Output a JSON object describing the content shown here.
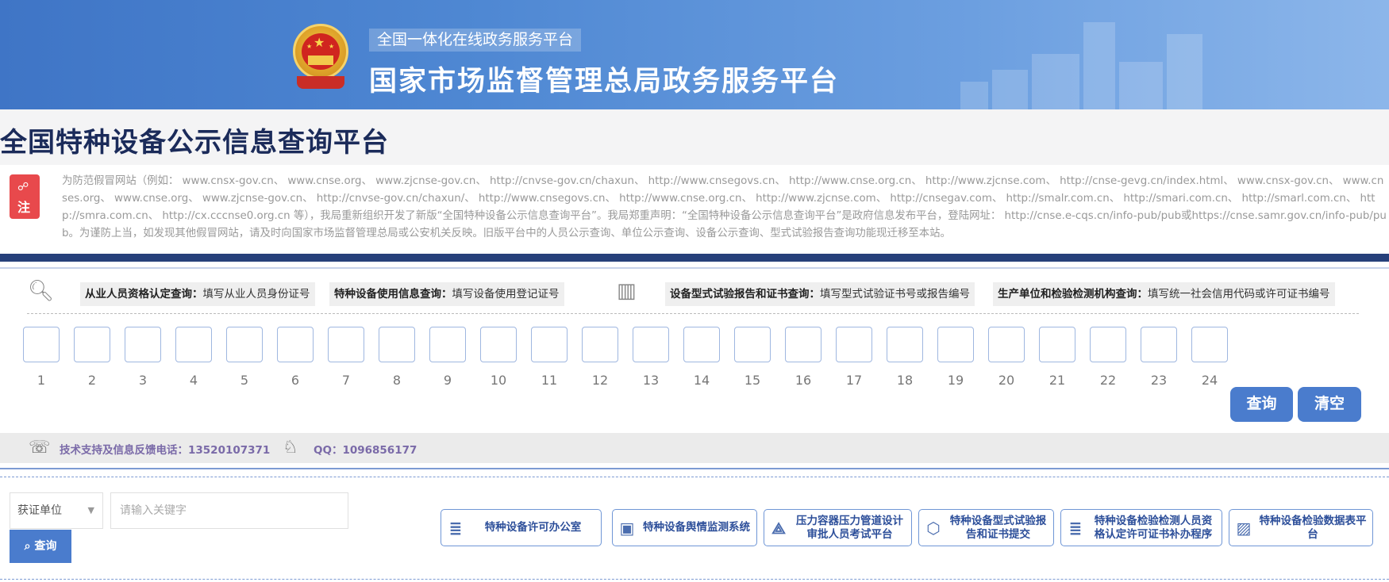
{
  "header": {
    "subtitle": "全国一体化在线政务服务平台",
    "title": "国家市场监督管理总局政务服务平台"
  },
  "platform_title": "全国特种设备公示信息查询平台",
  "notice": {
    "badge": "注",
    "text": "为防范假冒网站（例如： www.cnsx-gov.cn、 www.cnse.org、 www.zjcnse-gov.cn、 http://cnvse-gov.cn/chaxun、 http://www.cnsegovs.cn、 http://www.cnse.org.cn、 http://www.zjcnse.com、 http://cnse-gevg.cn/index.html、 www.cnsx-gov.cn、 www.cnses.org、 www.cnse.org、 www.zjcnse-gov.cn、 http://cnvse-gov.cn/chaxun/、 http://www.cnsegovs.cn、 http://www.cnse.org.cn、 http://www.zjcnse.com、 http://cnsegav.com、 http://smalr.com.cn、 http://smari.com.cn、 http://smarl.com.cn、 http://smra.com.cn、 http://cx.cccnse0.org.cn 等），我局重新组织开发了新版“全国特种设备公示信息查询平台”。我局郑重声明：“全国特种设备公示信息查询平台”是政府信息发布平台，登陆网址： http://cnse.e-cqs.cn/info-pub/pub或https://cnse.samr.gov.cn/info-pub/pub。为谨防上当，如发现其他假冒网站，请及时向国家市场监督管理总局或公安机关反映。旧版平台中的人员公示查询、单位公示查询、设备公示查询、型式试验报告查询功能现迁移至本站。"
  },
  "query_types": [
    {
      "label": "从业人员资格认定查询：",
      "hint": "填写从业人员身份证号"
    },
    {
      "label": "特种设备使用信息查询：",
      "hint": "填写设备使用登记证号"
    },
    {
      "label": "设备型式试验报告和证书查询：",
      "hint": "填写型式试验证书号或报告编号"
    },
    {
      "label": "生产单位和检验检测机构查询：",
      "hint": "填写统一社会信用代码或许可证书编号"
    }
  ],
  "cell_numbers": [
    "1",
    "2",
    "3",
    "4",
    "5",
    "6",
    "7",
    "8",
    "9",
    "10",
    "11",
    "12",
    "13",
    "14",
    "15",
    "16",
    "17",
    "18",
    "19",
    "20",
    "21",
    "22",
    "23",
    "24"
  ],
  "buttons": {
    "query": "查询",
    "clear": "清空"
  },
  "support": {
    "phone": "技术支持及信息反馈电话：13520107371",
    "qq": "QQ：1096856177"
  },
  "search": {
    "select_value": "获证单位",
    "placeholder": "请输入关键字",
    "button": "查询"
  },
  "links": [
    {
      "label": "特种设备许可办公室",
      "icon": "list-icon"
    },
    {
      "label": "特种设备舆情监测系统",
      "icon": "monitor-icon"
    },
    {
      "label": "压力容器压力管道设计审批人员考试平台",
      "icon": "compass-icon"
    },
    {
      "label": "特种设备型式试验报告和证书提交",
      "icon": "cube-icon"
    },
    {
      "label": "特种设备检验检测人员资格认定许可证书补办程序",
      "icon": "list-icon"
    },
    {
      "label": "特种设备检验数据表平台",
      "icon": "image-icon"
    }
  ],
  "colors": {
    "header": "#4f88d3",
    "accent": "#4a7ccd",
    "dark_bar": "#26407a",
    "notice_badge": "#e8494c"
  }
}
